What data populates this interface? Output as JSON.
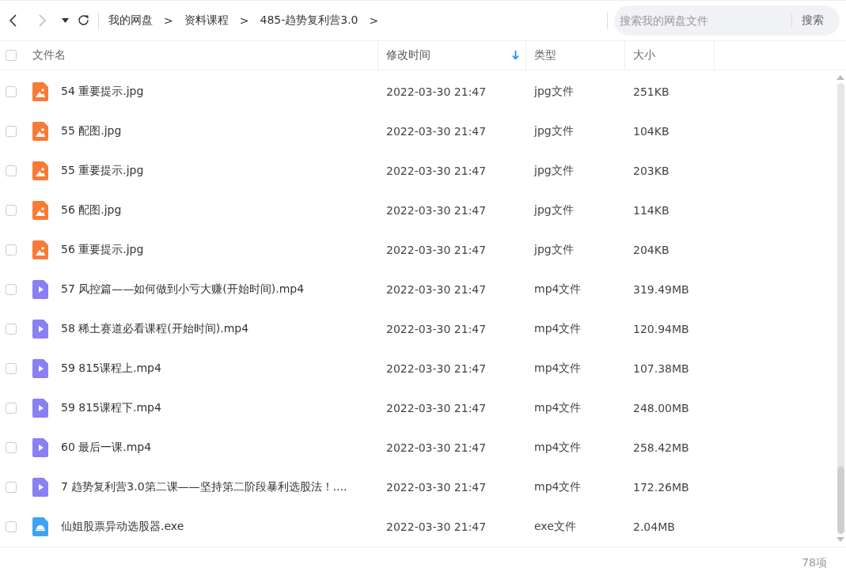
{
  "toolbar": {
    "breadcrumbs": [
      "我的网盘",
      "资料课程",
      "485-趋势复利营3.0"
    ],
    "separator": ">",
    "search": {
      "placeholder": "搜索我的网盘文件",
      "button": "搜索"
    }
  },
  "table": {
    "select_all": {
      "checked": false
    },
    "columns": [
      {
        "label": "文件名",
        "sorted": false
      },
      {
        "label": "修改时间",
        "sorted": true
      },
      {
        "label": "类型",
        "sorted": false
      },
      {
        "label": "大小",
        "sorted": false
      }
    ],
    "rows": [
      {
        "kind": "image",
        "checked": false,
        "name": "54 重要提示.jpg",
        "modified": "2022-03-30 21:47",
        "type": "jpg文件",
        "size": "251KB"
      },
      {
        "kind": "image",
        "checked": false,
        "name": "55 配图.jpg",
        "modified": "2022-03-30 21:47",
        "type": "jpg文件",
        "size": "104KB"
      },
      {
        "kind": "image",
        "checked": false,
        "name": "55 重要提示.jpg",
        "modified": "2022-03-30 21:47",
        "type": "jpg文件",
        "size": "203KB"
      },
      {
        "kind": "image",
        "checked": false,
        "name": "56 配图.jpg",
        "modified": "2022-03-30 21:47",
        "type": "jpg文件",
        "size": "114KB"
      },
      {
        "kind": "image",
        "checked": false,
        "name": "56 重要提示.jpg",
        "modified": "2022-03-30 21:47",
        "type": "jpg文件",
        "size": "204KB"
      },
      {
        "kind": "video",
        "checked": false,
        "name": "57 风控篇——如何做到小亏大赚(开始时间).mp4",
        "modified": "2022-03-30 21:47",
        "type": "mp4文件",
        "size": "319.49MB"
      },
      {
        "kind": "video",
        "checked": false,
        "name": "58 稀土赛道必看课程(开始时间).mp4",
        "modified": "2022-03-30 21:47",
        "type": "mp4文件",
        "size": "120.94MB"
      },
      {
        "kind": "video",
        "checked": false,
        "name": "59 815课程上.mp4",
        "modified": "2022-03-30 21:47",
        "type": "mp4文件",
        "size": "107.38MB"
      },
      {
        "kind": "video",
        "checked": false,
        "name": "59 815课程下.mp4",
        "modified": "2022-03-30 21:47",
        "type": "mp4文件",
        "size": "248.00MB"
      },
      {
        "kind": "video",
        "checked": false,
        "name": "60 最后一课.mp4",
        "modified": "2022-03-30 21:47",
        "type": "mp4文件",
        "size": "258.42MB"
      },
      {
        "kind": "video",
        "checked": false,
        "name": "7 趋势复利营3.0第二课——坚持第二阶段暴利选股法！....",
        "modified": "2022-03-30 21:47",
        "type": "mp4文件",
        "size": "172.26MB"
      },
      {
        "kind": "exe",
        "checked": false,
        "name": "仙姐股票异动选股器.exe",
        "modified": "2022-03-30 21:47",
        "type": "exe文件",
        "size": "2.04MB"
      }
    ]
  },
  "status_bar": {
    "count": "78项"
  }
}
